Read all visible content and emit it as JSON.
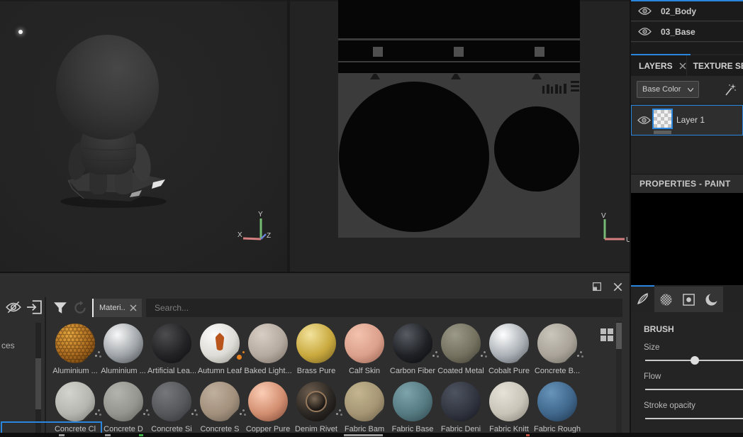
{
  "colors": {
    "accent": "#2a86dd",
    "panel_dark": "#1b1b1b",
    "shelf_bg": "#2e2e2e",
    "uv_canvas_bg": "#3b3b3b",
    "axis_x_red": "#d47e7e",
    "axis_y_green": "#74b974",
    "axis_z_blue": "#6b7fd4"
  },
  "icons": {
    "eye": "visibility-toggle",
    "eye-off": "hide-resources",
    "import": "import-resources",
    "filter": "funnel-filter",
    "refresh": "reload-shelf",
    "close": "x-close",
    "float": "undock-panel",
    "wand": "effects-wand",
    "chevron": "dropdown-chevron",
    "grid": "grid-view",
    "brush": "paint-brush-tool",
    "alpha": "checker-circle-alpha",
    "stencil": "square-dot-stencil",
    "material-ball": "sphere-crescent-material"
  },
  "right_panel": {
    "texture_set_list": [
      {
        "label": "02_Body"
      },
      {
        "label": "03_Base"
      }
    ],
    "tabs": {
      "layers": "LAYERS",
      "texture_set": "TEXTURE SET"
    },
    "channel_dropdown": {
      "value": "Base Color"
    },
    "layer": {
      "name": "Layer 1"
    },
    "properties_header": "PROPERTIES - PAINT",
    "brush": {
      "header": "BRUSH",
      "size_label": "Size",
      "flow_label": "Flow",
      "stroke_opacity_label": "Stroke opacity"
    }
  },
  "viewport3d": {
    "axis_x": "X",
    "axis_y": "Y",
    "axis_z": "Z"
  },
  "viewport2d": {
    "axis_u": "U",
    "axis_v": "V"
  },
  "shelf": {
    "tab_label": "Materi..",
    "search_placeholder": "Search...",
    "sidebar_item": "ces",
    "materials_row1": [
      {
        "name": "Aluminium ...",
        "c1": "#e6a63f",
        "c2": "#a86a20",
        "c3": "#553208",
        "cut": true,
        "badge": "gray",
        "overlay": "honeycomb"
      },
      {
        "name": "Aluminium ...",
        "c1": "#f8f8f8",
        "c2": "#9fa4a8",
        "c3": "#43474b",
        "cut": false,
        "badge": null,
        "overlay": null
      },
      {
        "name": "Artificial Lea...",
        "c1": "#4d4d50",
        "c2": "#232326",
        "c3": "#0c0c0e",
        "cut": true,
        "badge": null,
        "overlay": null
      },
      {
        "name": "Autumn Leaf",
        "c1": "#fbfbfb",
        "c2": "#dedcd6",
        "c3": "#8e8c84",
        "cut": true,
        "badge": "orange",
        "overlay": "leaf"
      },
      {
        "name": "Baked Light...",
        "c1": "#d9cec5",
        "c2": "#b5aa9f",
        "c3": "#6f675f",
        "cut": false,
        "badge": null,
        "overlay": null
      },
      {
        "name": "Brass Pure",
        "c1": "#f2e29c",
        "c2": "#c9a93e",
        "c3": "#6b581d",
        "cut": false,
        "badge": null,
        "overlay": null
      },
      {
        "name": "Calf Skin",
        "c1": "#f2c2ae",
        "c2": "#dba08b",
        "c3": "#8f5c4b",
        "cut": false,
        "badge": null,
        "overlay": null
      },
      {
        "name": "Carbon Fiber",
        "c1": "#585c63",
        "c2": "#1f2125",
        "c3": "#08090b",
        "cut": true,
        "badge": "gray",
        "overlay": null
      },
      {
        "name": "Coated Metal",
        "c1": "#9b9989",
        "c2": "#74715f",
        "c3": "#3b392f",
        "cut": true,
        "badge": "gray",
        "overlay": null
      },
      {
        "name": "Cobalt Pure",
        "c1": "#ffffff",
        "c2": "#aab0b5",
        "c3": "#4f545a",
        "cut": true,
        "badge": null,
        "overlay": null
      },
      {
        "name": "Concrete B...",
        "c1": "#cac6bc",
        "c2": "#a9a399",
        "c3": "#69655d",
        "cut": true,
        "badge": "gray",
        "overlay": null
      }
    ],
    "materials_row2": [
      {
        "name": "Concrete Cl",
        "c1": "#d4d4ce",
        "c2": "#b6b6b0",
        "c3": "#757571",
        "cut": true,
        "badge": "gray",
        "overlay": null
      },
      {
        "name": "Concrete D",
        "c1": "#b4b4ae",
        "c2": "#95958f",
        "c3": "#5c5c58",
        "cut": true,
        "badge": "gray",
        "overlay": null
      },
      {
        "name": "Concrete Si",
        "c1": "#75777b",
        "c2": "#55575b",
        "c3": "#2e3034",
        "cut": true,
        "badge": "gray",
        "overlay": null
      },
      {
        "name": "Concrete S",
        "c1": "#bfaf9d",
        "c2": "#a2907c",
        "c3": "#61564a",
        "cut": true,
        "badge": "gray",
        "overlay": null
      },
      {
        "name": "Copper Pure",
        "c1": "#fbcdb5",
        "c2": "#d28e70",
        "c3": "#744232",
        "cut": false,
        "badge": null,
        "overlay": null
      },
      {
        "name": "Denim Rivet",
        "c1": "#6d5d4e",
        "c2": "#2b2723",
        "c3": "#0b0908",
        "cut": true,
        "badge": "gray",
        "overlay": "rivet"
      },
      {
        "name": "Fabric Bam",
        "c1": "#c4b690",
        "c2": "#a59574",
        "c3": "#655a43",
        "cut": true,
        "badge": null,
        "overlay": null
      },
      {
        "name": "Fabric Base",
        "c1": "#7da3ab",
        "c2": "#567a81",
        "c3": "#2b434a",
        "cut": false,
        "badge": null,
        "overlay": null
      },
      {
        "name": "Fabric Deni",
        "c1": "#4e5460",
        "c2": "#313540",
        "c3": "#14161c",
        "cut": false,
        "badge": null,
        "overlay": null
      },
      {
        "name": "Fabric Knitt",
        "c1": "#e6e2d8",
        "c2": "#c8c4b8",
        "c3": "#7f7b71",
        "cut": false,
        "badge": null,
        "overlay": null
      },
      {
        "name": "Fabric Rough",
        "c1": "#6794ba",
        "c2": "#40678c",
        "c3": "#1d3349",
        "cut": false,
        "badge": null,
        "overlay": null
      }
    ]
  }
}
